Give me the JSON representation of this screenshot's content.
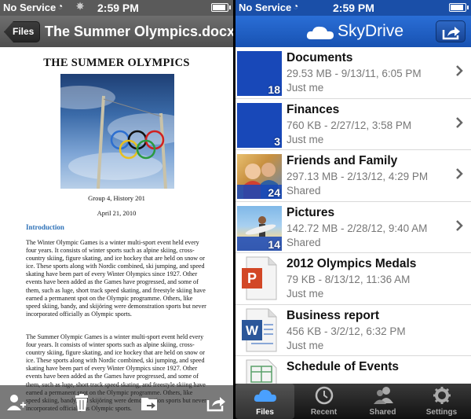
{
  "left_screen": {
    "status_bar": {
      "carrier": "No Service",
      "time": "2:59 PM"
    },
    "nav": {
      "back_label": "Files",
      "title": "The Summer Olympics.docx"
    },
    "document": {
      "heading": "THE SUMMER OLYMPICS",
      "group_line": "Group 4, History 201",
      "date_line": "April 21, 2010",
      "section_title": "Introduction",
      "paragraph_1": "The Winter Olympic Games is a winter multi-sport event held every four years. It consists of winter sports such as alpine skiing, cross-country skiing, figure skating, and ice hockey that are held on snow or ice. These sports along with Nordic combined, ski jumping, and speed skating have been part of every Winter Olympics since 1927. Other events have been added as the Games have progressed, and some of them, such as luge, short track speed skating, and freestyle skiing have earned a permanent spot on the Olympic programme. Others, like speed skiing, bandy, and skijöring were demonstration sports but never incorporated officially as Olympic sports.",
      "paragraph_2": "The Summer Olympic Games is a winter multi-sport event held every four years. It consists of winter sports such as alpine skiing, cross-country skiing, figure skating, and ice hockey that are held on snow or ice. These sports along with Nordic combined, ski jumping, and speed skating have been part of every Winter Olympics since 1927. Other events have been added as the Games have progressed, and some of them, such as luge, short track speed skating, and freestyle skiing have earned a permanent spot on the Olympic programme. Others, like speed skiing, bandy, and skijöring were demonstration sports but never incorporated officially as Olympic sports."
    },
    "toolbar_icons": [
      "add-person-icon",
      "trash-icon",
      "move-to-folder-icon",
      "share-icon"
    ]
  },
  "right_screen": {
    "status_bar": {
      "carrier": "No Service",
      "time": "2:59 PM"
    },
    "nav": {
      "brand": "SkyDrive"
    },
    "files": [
      {
        "name": "Documents",
        "info": "29.53 MB - 9/13/11, 6:05 PM",
        "owner": "Just me",
        "count": "18",
        "kind": "folder",
        "chevron": true
      },
      {
        "name": "Finances",
        "info": "760 KB - 2/27/12, 3:58 PM",
        "owner": "Just me",
        "count": "3",
        "kind": "folder",
        "chevron": true
      },
      {
        "name": "Friends and Family",
        "info": "297.13 MB - 2/13/12, 4:29 PM",
        "owner": "Shared",
        "count": "24",
        "kind": "photo-folder",
        "chevron": true
      },
      {
        "name": "Pictures",
        "info": "142.72 MB - 2/28/12, 9:40 AM",
        "owner": "Shared",
        "count": "14",
        "kind": "photo-folder",
        "chevron": true
      },
      {
        "name": "2012 Olympics Medals",
        "info": "79 KB - 8/13/12, 11:36 AM",
        "owner": "Just me",
        "count": "",
        "kind": "powerpoint",
        "chevron": false
      },
      {
        "name": "Business report",
        "info": "456 KB - 3/2/12, 6:32 PM",
        "owner": "Just me",
        "count": "",
        "kind": "word",
        "chevron": false
      },
      {
        "name": "Schedule of Events",
        "info": "",
        "owner": "",
        "count": "",
        "kind": "excel",
        "chevron": false
      }
    ],
    "tabs": [
      {
        "label": "Files",
        "icon": "cloud-icon",
        "active": true
      },
      {
        "label": "Recent",
        "icon": "clock-icon",
        "active": false
      },
      {
        "label": "Shared",
        "icon": "people-icon",
        "active": false
      },
      {
        "label": "Settings",
        "icon": "gear-icon",
        "active": false
      }
    ],
    "colors": {
      "accent": "#1848b8",
      "nav": "#2163c8"
    }
  }
}
